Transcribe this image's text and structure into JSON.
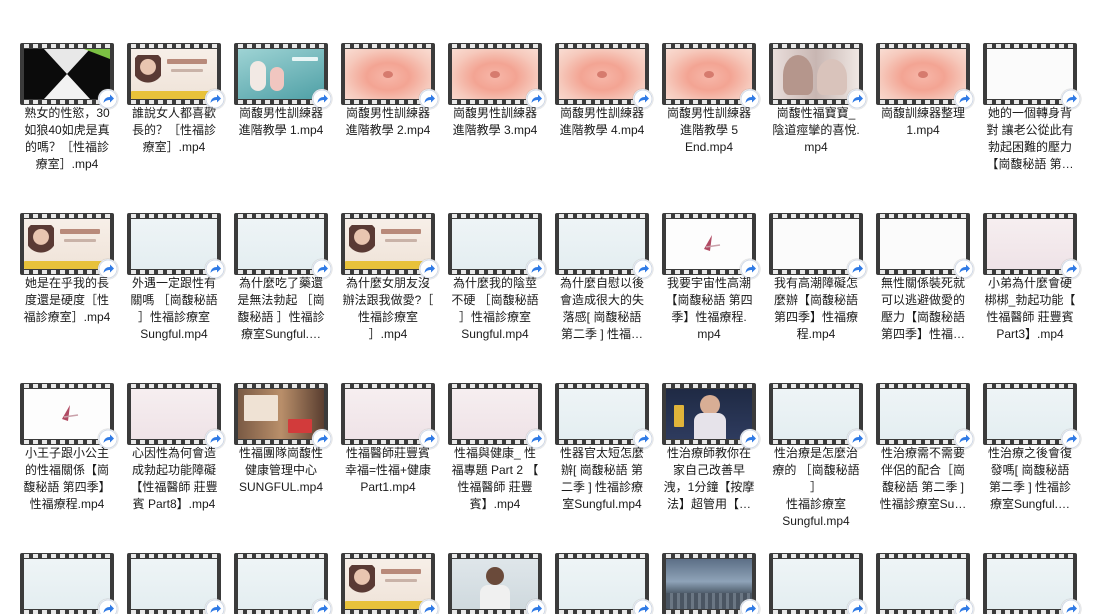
{
  "files": [
    {
      "name": "熟女的性慾，30\n如狼40如虎是真\n的嗎？［性福診\n療室］.mp4",
      "thumb": "x-shape"
    },
    {
      "name": "誰說女人都喜歡\n長的？［性福診\n療室］.mp4",
      "thumb": "host-banner"
    },
    {
      "name": "崗馥男性訓練器\n進階教學 1.mp4",
      "thumb": "product"
    },
    {
      "name": "崗馥男性訓練器\n進階教學 2.mp4",
      "thumb": "pink-skin"
    },
    {
      "name": "崗馥男性訓練器\n進階教學 3.mp4",
      "thumb": "pink-skin"
    },
    {
      "name": "崗馥男性訓練器\n進階教學 4.mp4",
      "thumb": "pink-skin"
    },
    {
      "name": "崗馥男性訓練器\n進階教學 5\nEnd.mp4",
      "thumb": "pink-skin"
    },
    {
      "name": "崗馥性福寶寶_\n陰道痙攣的喜悅.\nmp4",
      "thumb": "couple"
    },
    {
      "name": "崗馥訓練器整理\n1.mp4",
      "thumb": "pink-skin"
    },
    {
      "name": "她的一個轉身背\n對  讓老公從此有\n勃起困難的壓力\n【崗馥秘語 第…",
      "thumb": "blank-white"
    },
    {
      "name": "她是在乎我的長\n度還是硬度［性\n福診療室］.mp4",
      "thumb": "host-banner"
    },
    {
      "name": "外遇一定跟性有\n關嗎 ［崗馥秘語\n］性福診療室\nSungful.mp4",
      "thumb": "light-blue"
    },
    {
      "name": "為什麼吃了藥還\n是無法勃起 ［崗\n馥秘語 ］性福診\n療室Sungful.…",
      "thumb": "light-blue"
    },
    {
      "name": "為什麼女朋友沒\n辦法跟我做愛?［\n性福診療室\n］.mp4",
      "thumb": "host-banner"
    },
    {
      "name": "為什麼我的陰莖\n不硬 ［崗馥秘語\n］性福診療室\nSungful.mp4",
      "thumb": "light-blue"
    },
    {
      "name": "為什麼自慰以後\n會造成很大的失\n落感[ 崗馥秘語\n第二季 ] 性福…",
      "thumb": "light-blue"
    },
    {
      "name": "我要宇宙性高潮\n【崗馥秘語 第四\n季】性福療程.\nmp4",
      "thumb": "title-card"
    },
    {
      "name": "我有高潮障礙怎\n麼辦【崗馥秘語\n第四季】性福療\n程.mp4",
      "thumb": "blank-white"
    },
    {
      "name": "無性關係裝死就\n可以逃避做愛的\n壓力【崗馥秘語\n第四季】性福…",
      "thumb": "blank-white"
    },
    {
      "name": "小弟為什麼會硬\n梆梆_勃起功能【\n性福醫師 莊豐賓\nPart3】.mp4",
      "thumb": "light-pink"
    },
    {
      "name": "小王子跟小公主\n的性福關係【崗\n馥秘語 第四季】\n性福療程.mp4",
      "thumb": "title-card"
    },
    {
      "name": "心因性為何會造\n成勃起功能障礙\n【性福醫師 莊豐\n賓 Part8】.mp4",
      "thumb": "light-pink"
    },
    {
      "name": "性福團隊崗馥性\n健康管理中心\nSUNGFUL.mp4",
      "thumb": "office"
    },
    {
      "name": "性福醫師莊豐賓\n幸福=性福+健康\nPart1.mp4",
      "thumb": "light-pink"
    },
    {
      "name": "性福與健康_ 性\n福專題 Part 2 【\n性福醫師 莊豐\n賓】.mp4",
      "thumb": "light-pink"
    },
    {
      "name": "性器官太短怎麼\n辦[ 崗馥秘語 第\n二季 ] 性福診療\n室Sungful.mp4",
      "thumb": "light-blue"
    },
    {
      "name": "性治療師教你在\n家自己改善早\n洩，1分鐘【按摩\n法】超管用【…",
      "thumb": "presenter"
    },
    {
      "name": "性治療是怎麼治\n療的 ［崗馥秘語 ］\n性福診療室\nSungful.mp4",
      "thumb": "light-blue"
    },
    {
      "name": "性治療需不需要\n伴侶的配合［崗\n馥秘語 第二季 ]\n性福診療室Su…",
      "thumb": "light-blue"
    },
    {
      "name": "性治療之後會復\n發嗎[ 崗馥秘語\n第二季 ] 性福診\n療室Sungful.…",
      "thumb": "light-blue"
    },
    {
      "name": "",
      "thumb": "light-blue"
    },
    {
      "name": "",
      "thumb": "light-blue"
    },
    {
      "name": "",
      "thumb": "light-blue"
    },
    {
      "name": "",
      "thumb": "host-banner"
    },
    {
      "name": "",
      "thumb": "presenter-small"
    },
    {
      "name": "",
      "thumb": "light-blue"
    },
    {
      "name": "",
      "thumb": "city"
    },
    {
      "name": "",
      "thumb": "light-blue"
    },
    {
      "name": "",
      "thumb": "light-blue"
    },
    {
      "name": "",
      "thumb": "light-blue"
    }
  ]
}
